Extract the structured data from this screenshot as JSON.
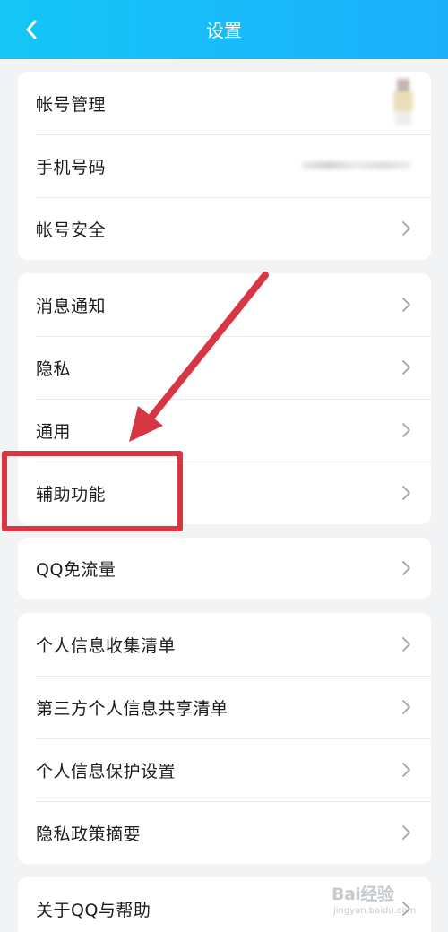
{
  "header": {
    "title": "设置",
    "colors": {
      "gradient_start": "#14c6f6",
      "gradient_end": "#1cb0fb",
      "text": "#ffffff"
    },
    "back_icon": "chevron-left-icon"
  },
  "sections": [
    {
      "items": [
        {
          "label": "帐号管理",
          "trailing": "avatar-thumbnail"
        },
        {
          "label": "手机号码",
          "trailing": "blurred-value"
        },
        {
          "label": "帐号安全",
          "trailing": "chevron-right-icon"
        }
      ]
    },
    {
      "items": [
        {
          "label": "消息通知",
          "trailing": "chevron-right-icon"
        },
        {
          "label": "隐私",
          "trailing": "chevron-right-icon"
        },
        {
          "label": "通用",
          "trailing": "chevron-right-icon"
        },
        {
          "label": "辅助功能",
          "trailing": "chevron-right-icon",
          "highlighted": true
        }
      ]
    },
    {
      "items": [
        {
          "label": "QQ免流量",
          "trailing": "chevron-right-icon"
        }
      ]
    },
    {
      "items": [
        {
          "label": "个人信息收集清单",
          "trailing": "chevron-right-icon"
        },
        {
          "label": "第三方个人信息共享清单",
          "trailing": "chevron-right-icon"
        },
        {
          "label": "个人信息保护设置",
          "trailing": "chevron-right-icon"
        },
        {
          "label": "隐私政策摘要",
          "trailing": "chevron-right-icon"
        }
      ]
    },
    {
      "items": [
        {
          "label": "关于QQ与帮助",
          "trailing": "chevron-right-icon"
        }
      ]
    }
  ],
  "annotation": {
    "color": "#d93644",
    "arrow_icon": "red-arrow-icon",
    "box_target": "辅助功能"
  },
  "watermark": {
    "logo": "Bai经验",
    "sub": "jingyan.baidu.com"
  },
  "colors": {
    "background": "#f2f3f5",
    "card": "#ffffff",
    "text": "#1c1c1c",
    "chevron": "#a4a4a4"
  }
}
